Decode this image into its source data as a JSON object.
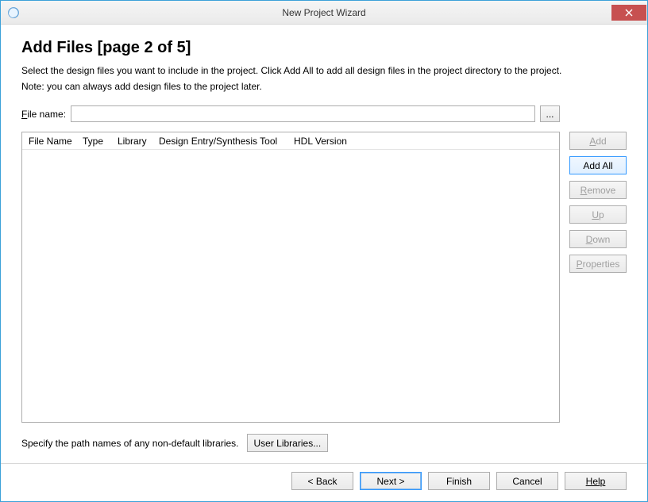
{
  "window": {
    "title": "New Project Wizard"
  },
  "heading": "Add Files [page 2 of 5]",
  "description": "Select the design files you want to include in the project. Click Add All to add all design files in the project directory to the project.",
  "note": "Note: you can always add design files to the project later.",
  "file_name_label_prefix": "F",
  "file_name_label_rest": "ile name:",
  "file_name_value": "",
  "browse_label": "...",
  "columns": [
    "File Name",
    "Type",
    "Library",
    "Design Entry/Synthesis Tool",
    "HDL Version"
  ],
  "buttons": {
    "add_u": "A",
    "add_rest": "dd",
    "add_all": "Add All",
    "remove_u": "R",
    "remove_rest": "emove",
    "up_u": "U",
    "up_rest": "p",
    "down_u": "D",
    "down_rest": "own",
    "properties_u": "P",
    "properties_rest": "roperties"
  },
  "bottom_text": "Specify the path names of any non-default libraries.",
  "user_libraries_label": "User Libraries...",
  "footer": {
    "back": "< Back",
    "next": "Next >",
    "finish": "Finish",
    "cancel": "Cancel",
    "help": "Help"
  }
}
